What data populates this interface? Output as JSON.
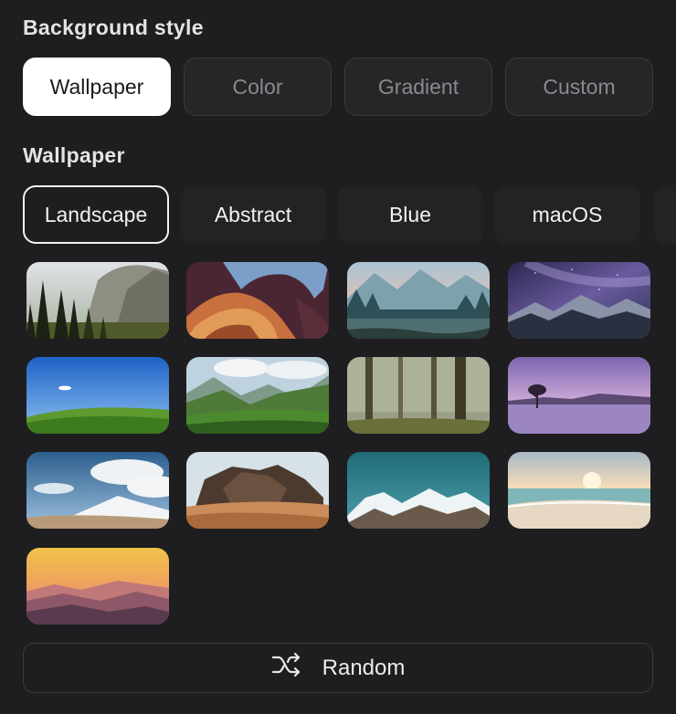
{
  "background_style": {
    "title": "Background style",
    "options": [
      "Wallpaper",
      "Color",
      "Gradient",
      "Custom"
    ],
    "selected": "Wallpaper"
  },
  "wallpaper": {
    "title": "Wallpaper",
    "categories": [
      "Landscape",
      "Abstract",
      "Blue",
      "macOS"
    ],
    "selected_category": "Landscape",
    "thumbnails": [
      "yosemite-valley",
      "antelope-canyon",
      "misty-lake-mountains",
      "milky-way-mountains",
      "green-hill-blue-sky",
      "alpine-valley",
      "foggy-forest",
      "purple-lake-tree",
      "snowy-peak-clouds",
      "desert-rock",
      "snow-mountain-range",
      "beach-sunset",
      "golden-mountain-haze"
    ]
  },
  "random": {
    "label": "Random",
    "icon": "shuffle-icon"
  }
}
